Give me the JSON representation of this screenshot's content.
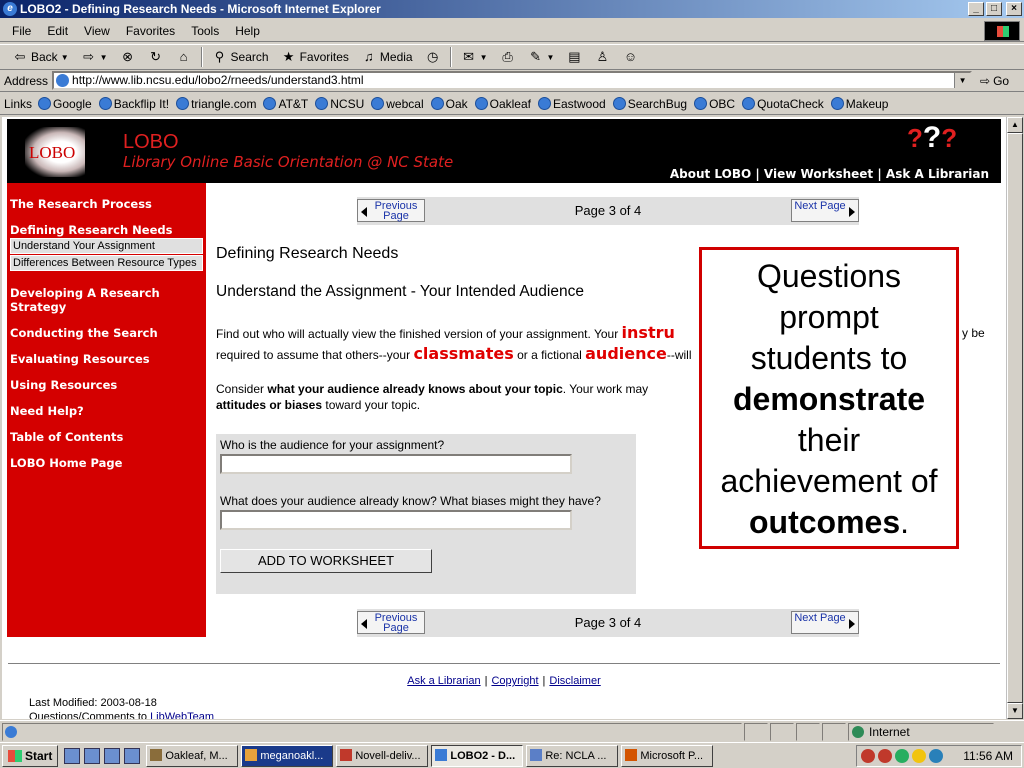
{
  "window": {
    "title": "LOBO2 - Defining Research Needs - Microsoft Internet Explorer"
  },
  "menu": [
    "File",
    "Edit",
    "View",
    "Favorites",
    "Tools",
    "Help"
  ],
  "toolbar": {
    "back": "Back",
    "search": "Search",
    "favorites": "Favorites",
    "media": "Media"
  },
  "address": {
    "label": "Address",
    "url": "http://www.lib.ncsu.edu/lobo2/rneeds/understand3.html",
    "go": "Go"
  },
  "links": {
    "label": "Links",
    "items": [
      "Google",
      "Backflip It!",
      "triangle.com",
      "AT&T",
      "NCSU",
      "webcal",
      "Oak",
      "Oakleaf",
      "Eastwood",
      "SearchBug",
      "OBC",
      "QuotaCheck",
      "Makeup"
    ]
  },
  "header": {
    "logo_text": "LOBO",
    "title": "LOBO",
    "subtitle": "Library Online Basic Orientation @ NC State",
    "nav": "About LOBO | View Worksheet | Ask A Librarian"
  },
  "sidebar": {
    "research_process": "The Research Process",
    "defining": "Defining Research Needs",
    "sub1": "Understand Your Assignment",
    "sub2": "Differences Between Resource Types",
    "developing": "Developing A Research Strategy",
    "conducting": "Conducting the Search",
    "evaluating": "Evaluating Resources",
    "using": "Using Resources",
    "help": "Need Help?",
    "toc": "Table of Contents",
    "home": "LOBO Home Page"
  },
  "pagenav": {
    "prev": "Previous Page",
    "next": "Next Page",
    "label": "Page 3 of 4"
  },
  "content": {
    "section_title": "Defining Research Needs",
    "subtitle": "Understand the Assignment - Your Intended Audience",
    "p1_a": "Find out who will actually view the finished version of your assignment. Your ",
    "p1_hl1": "instru",
    "p1_tail": "y be",
    "p1_b": "required to assume that others--your ",
    "p1_hl2": "classmates",
    "p1_c": " or a fictional ",
    "p1_hl3": "audience",
    "p1_d": "--will",
    "p2_a": "Consider ",
    "p2_bold1": "what your audience already knows about your topic",
    "p2_b": ". Your work may",
    "p2_bold2": "attitudes or biases",
    "p2_c": " toward your topic."
  },
  "form": {
    "q1": "Who is the audience for your assignment?",
    "q2": "What does your audience already know? What biases might they have?",
    "button": "ADD TO WORKSHEET"
  },
  "footer": {
    "ask": "Ask a Librarian",
    "copyright": "Copyright",
    "disclaimer": "Disclaimer",
    "modified": "Last Modified: 2003-08-18",
    "questions": "Questions/Comments to ",
    "team": "LibWebTeam"
  },
  "callout": {
    "l1": "Questions",
    "l2": "prompt",
    "l3": "students to",
    "l4": "demonstrate",
    "l5": "their",
    "l6": "achievement of",
    "l7": "outcomes",
    "l7_tail": "."
  },
  "status": {
    "zone": "Internet"
  },
  "taskbar": {
    "start": "Start",
    "tasks": [
      "Oakleaf, M...",
      "meganoakl...",
      "Novell-deliv...",
      "LOBO2 - D...",
      "Re: NCLA ...",
      "Microsoft P..."
    ],
    "time": "11:56 AM"
  }
}
